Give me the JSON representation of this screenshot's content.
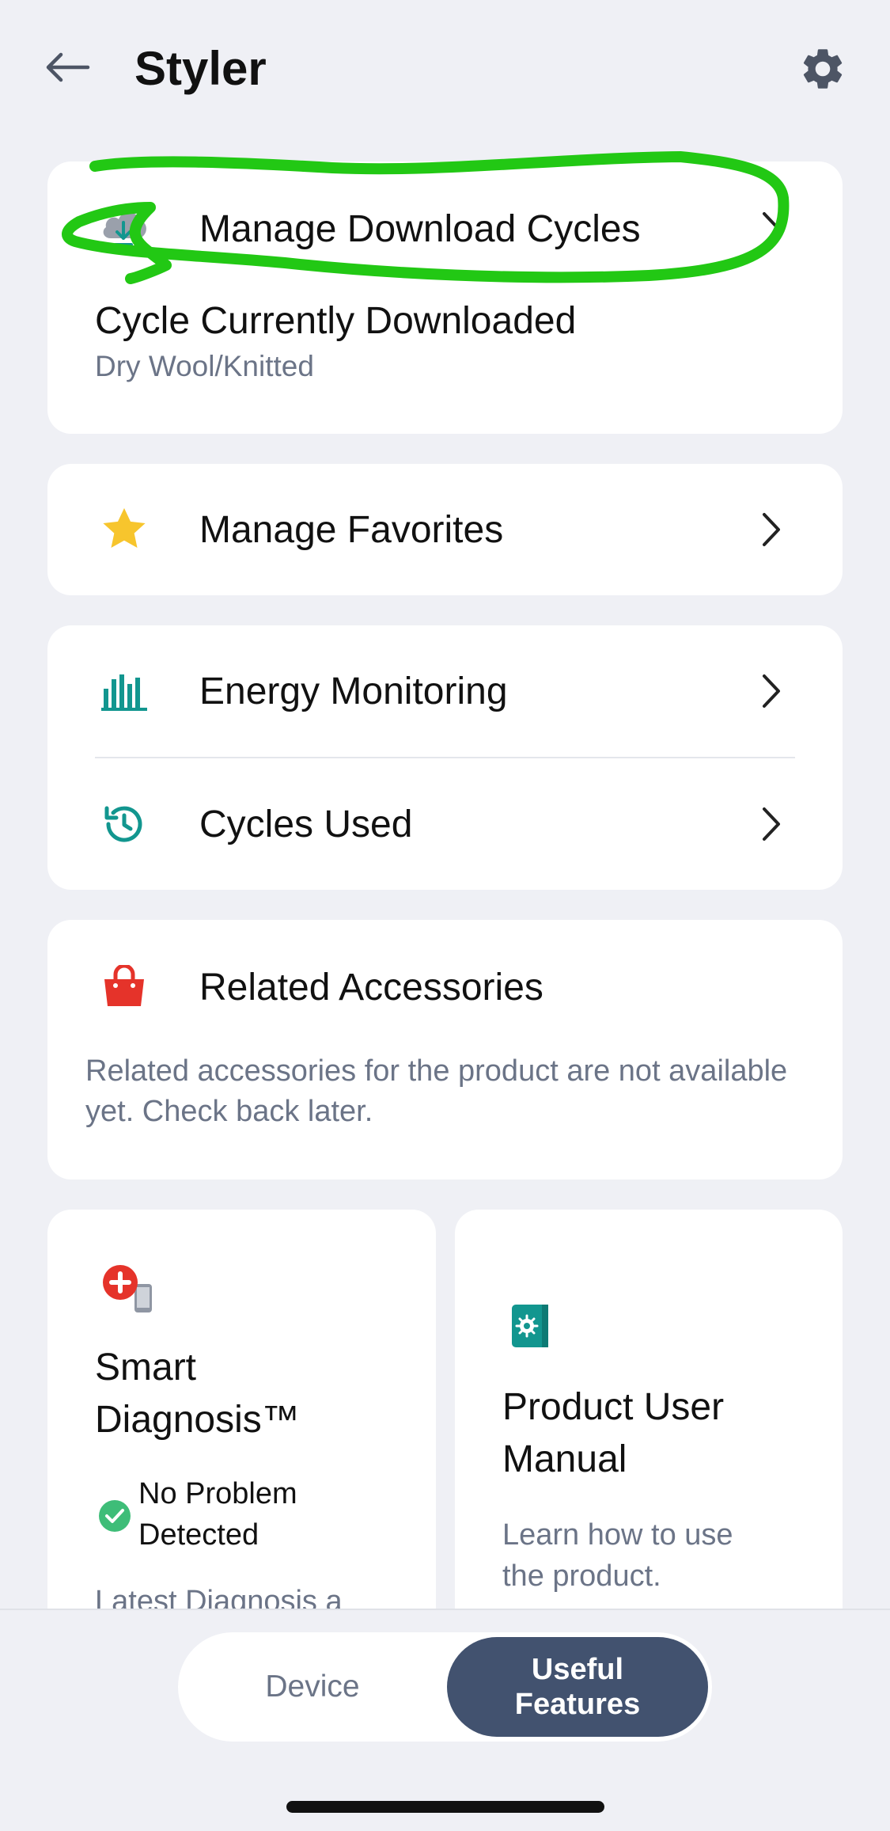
{
  "header": {
    "title": "Styler",
    "back_icon": "arrow-left-icon",
    "settings_icon": "gear-icon"
  },
  "download_card": {
    "manage_label": "Manage Download Cycles",
    "icon": "cloud-download-icon",
    "current_title": "Cycle Currently Downloaded",
    "current_value": "Dry Wool/Knitted"
  },
  "favorites": {
    "label": "Manage Favorites",
    "icon": "star-icon"
  },
  "monitoring": {
    "energy_label": "Energy Monitoring",
    "energy_icon": "bar-chart-icon",
    "cycles_label": "Cycles Used",
    "cycles_icon": "history-icon"
  },
  "accessories": {
    "label": "Related Accessories",
    "icon": "shopping-bag-icon",
    "description": "Related accessories for the product are not available yet. Check back later."
  },
  "smart_diagnosis": {
    "title_line1": "Smart",
    "title_line2": "Diagnosis™",
    "status_line1": "No Problem",
    "status_line2": "Detected",
    "latest": "Latest Diagnosis a"
  },
  "manual": {
    "title_line1": "Product User",
    "title_line2": "Manual",
    "desc_line1": "Learn how to use",
    "desc_line2": "the product."
  },
  "tabs": {
    "device": "Device",
    "useful_line1": "Useful",
    "useful_line2": "Features"
  },
  "colors": {
    "background": "#eff0f5",
    "card": "#ffffff",
    "accent_teal": "#12968f",
    "star": "#f7c52d",
    "red": "#e5332a",
    "tab_active": "#42526f",
    "annotation_green": "#22c814",
    "secondary_text": "#6b7487"
  }
}
